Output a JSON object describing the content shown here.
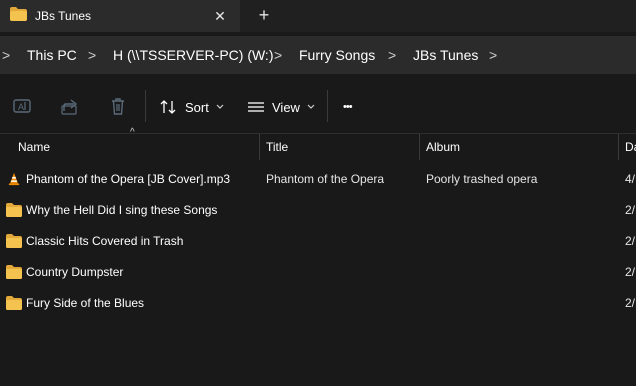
{
  "tab": {
    "title": "JBs Tunes",
    "close_glyph": "✕",
    "add_glyph": "+"
  },
  "breadcrumb": {
    "items": [
      "This PC",
      "H (\\\\TSSERVER-PC) (W:)",
      "Furry Songs",
      "JBs Tunes"
    ],
    "separator": ">"
  },
  "toolbar": {
    "sort_label": "Sort",
    "view_label": "View",
    "more_label": "•••"
  },
  "columns": {
    "name": "Name",
    "title": "Title",
    "album": "Album",
    "date": "Da"
  },
  "rows": [
    {
      "icon": "vlc-cone-icon",
      "name": "Phantom of the Opera [JB Cover].mp3",
      "title": "Phantom of the Opera",
      "album": "Poorly trashed opera",
      "date": "4/"
    },
    {
      "icon": "folder-icon",
      "name": "Why the Hell Did I sing these Songs",
      "title": "",
      "album": "",
      "date": "2/"
    },
    {
      "icon": "folder-icon",
      "name": "Classic Hits Covered in Trash",
      "title": "",
      "album": "",
      "date": "2/"
    },
    {
      "icon": "folder-icon",
      "name": "Country Dumpster",
      "title": "",
      "album": "",
      "date": "2/"
    },
    {
      "icon": "folder-icon",
      "name": "Fury Side of the Blues",
      "title": "",
      "album": "",
      "date": "2/"
    }
  ],
  "colors": {
    "folder": "#f4c34f",
    "folder_dark": "#e2a83a",
    "vlc": "#f08a00",
    "background": "#191919"
  }
}
